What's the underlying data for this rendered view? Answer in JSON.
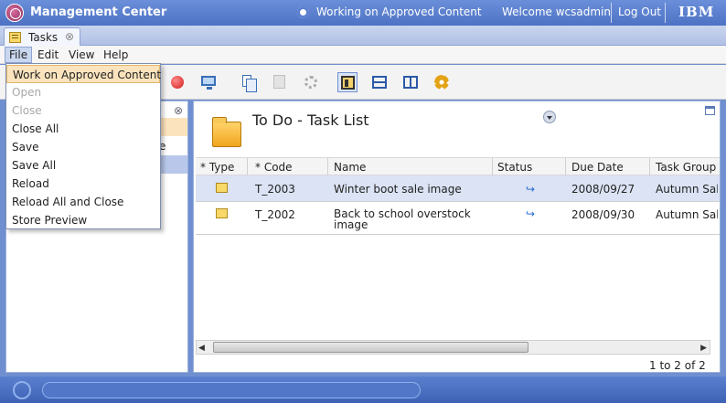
{
  "titlebar": {
    "app_title": "Management Center",
    "status_text": "Working on Approved Content",
    "welcome_text": "Welcome wcsadmin",
    "logout_label": "Log Out",
    "brand": "IBM"
  },
  "tabs": [
    {
      "label": "Tasks",
      "close": "⊗"
    }
  ],
  "menubar": {
    "items": [
      "File",
      "Edit",
      "View",
      "Help"
    ]
  },
  "file_menu": {
    "items": [
      {
        "label": "Work on Approved Content",
        "state": "selected"
      },
      {
        "label": "Open",
        "state": "disabled"
      },
      {
        "label": "Close",
        "state": "disabled"
      },
      {
        "label": "Close All",
        "state": "enabled"
      },
      {
        "label": "Save",
        "state": "enabled"
      },
      {
        "label": "Save All",
        "state": "enabled"
      },
      {
        "label": "Reload",
        "state": "enabled"
      },
      {
        "label": "Reload All and Close",
        "state": "enabled"
      },
      {
        "label": "Store Preview",
        "state": "enabled"
      }
    ]
  },
  "left_panel": {
    "close": "⊗",
    "partial_text": "e"
  },
  "panel": {
    "title": "To Do - Task List"
  },
  "grid": {
    "columns": [
      "* Type",
      "* Code",
      "Name",
      "Status",
      "Due Date",
      "Task Group"
    ],
    "rows": [
      {
        "code": "T_2003",
        "name": "Winter boot sale image",
        "status_icon": "arrow-icon",
        "due": "2008/09/27",
        "group": "Autumn Sale"
      },
      {
        "code": "T_2002",
        "name": "Back to school overstock image",
        "status_icon": "arrow-icon",
        "due": "2008/09/30",
        "group": "Autumn Sale"
      }
    ],
    "pager": "1 to 2 of 2"
  },
  "colors": {
    "titlebar": "#4d72c4",
    "selection": "#fbe4bd",
    "row_selected": "#dbe3f4"
  }
}
